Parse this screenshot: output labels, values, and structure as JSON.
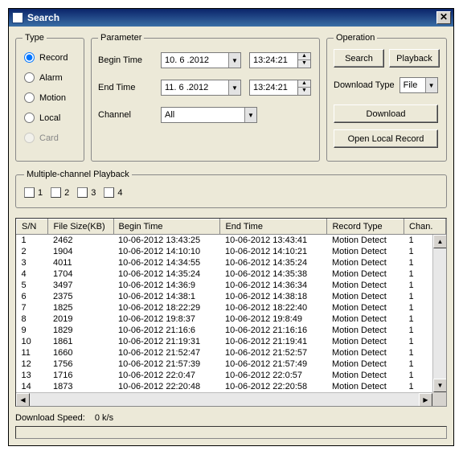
{
  "window": {
    "title": "Search",
    "close_glyph": "✕"
  },
  "type": {
    "legend": "Type",
    "options": [
      {
        "label": "Record",
        "checked": true,
        "disabled": false
      },
      {
        "label": "Alarm",
        "checked": false,
        "disabled": false
      },
      {
        "label": "Motion",
        "checked": false,
        "disabled": false
      },
      {
        "label": "Local",
        "checked": false,
        "disabled": false
      },
      {
        "label": "Card",
        "checked": false,
        "disabled": true
      }
    ]
  },
  "parameter": {
    "legend": "Parameter",
    "begin_label": "Begin Time",
    "end_label": "End Time",
    "channel_label": "Channel",
    "begin_date": "10. 6 .2012",
    "begin_time": "13:24:21",
    "end_date": "11. 6 .2012",
    "end_time": "13:24:21",
    "channel_value": "All"
  },
  "operation": {
    "legend": "Operation",
    "search": "Search",
    "playback": "Playback",
    "dl_type_label": "Download Type",
    "dl_type_value": "File",
    "download": "Download",
    "open_local": "Open Local Record"
  },
  "multi": {
    "legend": "Multiple-channel Playback",
    "items": [
      "1",
      "2",
      "3",
      "4"
    ]
  },
  "table": {
    "headers": [
      "S/N",
      "File Size(KB)",
      "Begin Time",
      "End Time",
      "Record Type",
      "Chan."
    ],
    "rows": [
      [
        "1",
        "2462",
        "10-06-2012 13:43:25",
        "10-06-2012 13:43:41",
        "Motion Detect",
        "1"
      ],
      [
        "2",
        "1904",
        "10-06-2012 14:10:10",
        "10-06-2012 14:10:21",
        "Motion Detect",
        "1"
      ],
      [
        "3",
        "4011",
        "10-06-2012 14:34:55",
        "10-06-2012 14:35:24",
        "Motion Detect",
        "1"
      ],
      [
        "4",
        "1704",
        "10-06-2012 14:35:24",
        "10-06-2012 14:35:38",
        "Motion Detect",
        "1"
      ],
      [
        "5",
        "3497",
        "10-06-2012 14:36:9",
        "10-06-2012 14:36:34",
        "Motion Detect",
        "1"
      ],
      [
        "6",
        "2375",
        "10-06-2012 14:38:1",
        "10-06-2012 14:38:18",
        "Motion Detect",
        "1"
      ],
      [
        "7",
        "1825",
        "10-06-2012 18:22:29",
        "10-06-2012 18:22:40",
        "Motion Detect",
        "1"
      ],
      [
        "8",
        "2019",
        "10-06-2012 19:8:37",
        "10-06-2012 19:8:49",
        "Motion Detect",
        "1"
      ],
      [
        "9",
        "1829",
        "10-06-2012 21:16:6",
        "10-06-2012 21:16:16",
        "Motion Detect",
        "1"
      ],
      [
        "10",
        "1861",
        "10-06-2012 21:19:31",
        "10-06-2012 21:19:41",
        "Motion Detect",
        "1"
      ],
      [
        "11",
        "1660",
        "10-06-2012 21:52:47",
        "10-06-2012 21:52:57",
        "Motion Detect",
        "1"
      ],
      [
        "12",
        "1756",
        "10-06-2012 21:57:39",
        "10-06-2012 21:57:49",
        "Motion Detect",
        "1"
      ],
      [
        "13",
        "1716",
        "10-06-2012 22:0:47",
        "10-06-2012 22:0:57",
        "Motion Detect",
        "1"
      ],
      [
        "14",
        "1873",
        "10-06-2012 22:20:48",
        "10-06-2012 22:20:58",
        "Motion Detect",
        "1"
      ]
    ]
  },
  "footer": {
    "dl_speed_label": "Download Speed:",
    "dl_speed_value": "0 k/s"
  },
  "glyphs": {
    "down": "▼",
    "up": "▲",
    "left": "◀",
    "right": "▶"
  }
}
